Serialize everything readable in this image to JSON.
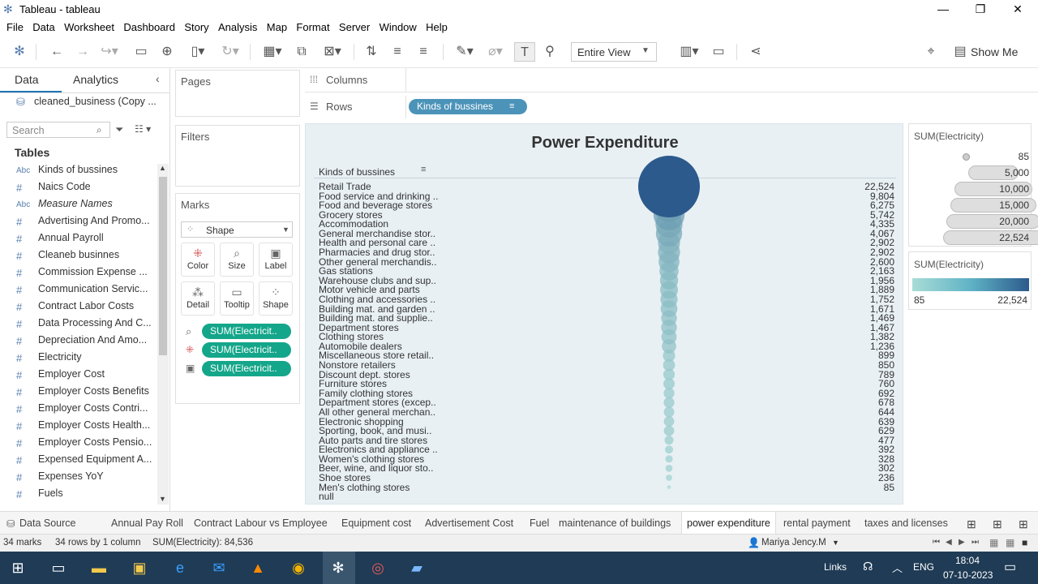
{
  "window": {
    "title": "Tableau - tableau",
    "minimize": "—",
    "restore": "❐",
    "close": "✕"
  },
  "menu": [
    "File",
    "Data",
    "Worksheet",
    "Dashboard",
    "Story",
    "Analysis",
    "Map",
    "Format",
    "Server",
    "Window",
    "Help"
  ],
  "toolbar": {
    "fit_label": "Entire View",
    "show_me_label": "Show Me"
  },
  "left_pane": {
    "tab_data": "Data",
    "tab_analytics": "Analytics",
    "datasource": "cleaned_business (Copy ...",
    "search_placeholder": "Search",
    "tables_heading": "Tables",
    "fields": [
      {
        "type": "Abc",
        "name": "Kinds of bussines",
        "italic": false
      },
      {
        "type": "#",
        "name": "Naics Code",
        "italic": false
      },
      {
        "type": "Abc",
        "name": "Measure Names",
        "italic": true
      },
      {
        "type": "#",
        "name": "Advertising And Promo...",
        "italic": false
      },
      {
        "type": "#",
        "name": "Annual Payroll",
        "italic": false
      },
      {
        "type": "#",
        "name": "Cleaneb businnes",
        "italic": false
      },
      {
        "type": "#",
        "name": "Commission Expense ...",
        "italic": false
      },
      {
        "type": "#",
        "name": "Communication Servic...",
        "italic": false
      },
      {
        "type": "#",
        "name": "Contract Labor Costs",
        "italic": false
      },
      {
        "type": "#",
        "name": "Data Processing And C...",
        "italic": false
      },
      {
        "type": "#",
        "name": "Depreciation And Amo...",
        "italic": false
      },
      {
        "type": "#",
        "name": "Electricity",
        "italic": false
      },
      {
        "type": "#",
        "name": "Employer Cost",
        "italic": false
      },
      {
        "type": "#",
        "name": "Employer Costs Benefits",
        "italic": false
      },
      {
        "type": "#",
        "name": "Employer Costs Contri...",
        "italic": false
      },
      {
        "type": "#",
        "name": "Employer Costs Health...",
        "italic": false
      },
      {
        "type": "#",
        "name": "Employer Costs Pensio...",
        "italic": false
      },
      {
        "type": "#",
        "name": "Expensed Equipment A...",
        "italic": false
      },
      {
        "type": "#",
        "name": "Expenses YoY",
        "italic": false
      },
      {
        "type": "#",
        "name": "Fuels",
        "italic": false
      }
    ]
  },
  "cards": {
    "pages": "Pages",
    "filters": "Filters",
    "marks": "Marks",
    "mark_type": "Shape",
    "mark_buttons": [
      "Color",
      "Size",
      "Label",
      "Detail",
      "Tooltip",
      "Shape"
    ],
    "mark_pills": [
      "SUM(Electricit..",
      "SUM(Electricit..",
      "SUM(Electricit.."
    ]
  },
  "shelves": {
    "columns": "Columns",
    "rows": "Rows",
    "rows_pill": "Kinds of bussines"
  },
  "chart_data": {
    "type": "bubble",
    "title": "Power Expenditure",
    "row_header": "Kinds of bussines",
    "measure": "SUM(Electricity)",
    "rows": [
      {
        "label": "Retail Trade",
        "value": 22524
      },
      {
        "label": "Food service and drinking ..",
        "value": 9804
      },
      {
        "label": "Food and beverage stores",
        "value": 6275
      },
      {
        "label": "Grocery stores",
        "value": 5742
      },
      {
        "label": "Accommodation",
        "value": 4335
      },
      {
        "label": "General merchandise stor..",
        "value": 4067
      },
      {
        "label": "Health and personal care ..",
        "value": 2902
      },
      {
        "label": "Pharmacies and drug stor..",
        "value": 2902
      },
      {
        "label": "Other general merchandis..",
        "value": 2600
      },
      {
        "label": "Gas stations",
        "value": 2163
      },
      {
        "label": "Warehouse clubs and sup..",
        "value": 1956
      },
      {
        "label": "Motor vehicle and parts",
        "value": 1889
      },
      {
        "label": "Clothing and accessories ..",
        "value": 1752
      },
      {
        "label": "Building mat. and garden ..",
        "value": 1671
      },
      {
        "label": "Building mat. and supplie..",
        "value": 1469
      },
      {
        "label": "Department stores",
        "value": 1467
      },
      {
        "label": "Clothing stores",
        "value": 1382
      },
      {
        "label": "Automobile dealers",
        "value": 1236
      },
      {
        "label": "Miscellaneous store retail..",
        "value": 899
      },
      {
        "label": "Nonstore retailers",
        "value": 850
      },
      {
        "label": "Discount dept. stores",
        "value": 789
      },
      {
        "label": "Furniture stores",
        "value": 760
      },
      {
        "label": "Family clothing stores",
        "value": 692
      },
      {
        "label": "Department stores (excep..",
        "value": 678
      },
      {
        "label": "All other general merchan..",
        "value": 644
      },
      {
        "label": "Electronic shopping",
        "value": 639
      },
      {
        "label": "Sporting, book, and  musi..",
        "value": 629
      },
      {
        "label": "Auto parts and tire stores",
        "value": 477
      },
      {
        "label": "Electronics and appliance ..",
        "value": 392
      },
      {
        "label": "Women's clothing stores",
        "value": 328
      },
      {
        "label": "Beer, wine, and liquor sto..",
        "value": 302
      },
      {
        "label": "Shoe stores",
        "value": 236
      },
      {
        "label": "Men's clothing stores",
        "value": 85
      },
      {
        "label": "null",
        "value": null
      }
    ],
    "color_low": "#a9dcd6",
    "color_high": "#2c5a8c"
  },
  "legends": {
    "size_title": "SUM(Electricity)",
    "size_items": [
      "85",
      "5,000",
      "10,000",
      "15,000",
      "20,000",
      "22,524"
    ],
    "color_title": "SUM(Electricity)",
    "color_min": "85",
    "color_max": "22,524"
  },
  "sheet_tabs": [
    "Data Source",
    "Annual Pay Roll",
    "Contract Labour vs Employee",
    "Equipment cost",
    "Advertisement Cost",
    "Fuel",
    "maintenance of buildings",
    "power expenditure",
    "rental payment",
    "taxes and licenses"
  ],
  "active_tab": "power expenditure",
  "status": {
    "marks": "34 marks",
    "rows_cols": "34 rows by 1 column",
    "sum": "SUM(Electricity): 84,536",
    "user": "Mariya Jency.M"
  },
  "taskbar": {
    "links": "Links",
    "lang": "ENG",
    "time": "18:04",
    "date": "07-10-2023"
  }
}
